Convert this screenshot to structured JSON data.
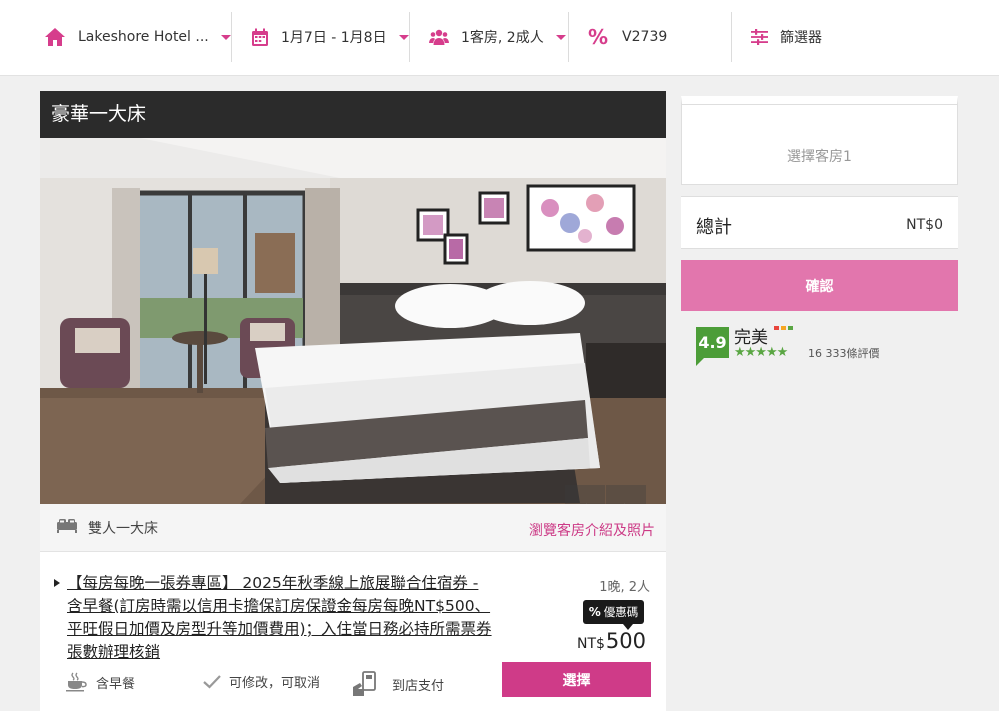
{
  "header": {
    "hotel_label": "Lakeshore Hotel ...",
    "dates_label": "1月7日 - 1月8日",
    "guests_label": "1客房, 2成人",
    "promo_code": "V2739",
    "filter_label": "篩選器"
  },
  "room": {
    "title": "豪華一大床",
    "carousel": {
      "total": 4,
      "active": 1
    },
    "bed_type": "雙人一大床",
    "browse_link": "瀏覽客房介紹及照片"
  },
  "offer": {
    "title": "【每房每晚一張券專區】 2025年秋季線上旅展聯合住宿券 - 含早餐(訂房時需以信用卡擔保訂房保證金每房每晚NT$500、平旺假日加價及房型升等加價費用)；入住當日務必持所需票券張數辦理核銷",
    "occupancy": "1晚, 2人",
    "coupon_label": "優惠碼",
    "price_currency": "NT$",
    "price_amount": "500",
    "select_label": "選擇",
    "features": {
      "breakfast": "含早餐",
      "modify": "可修改，可取消",
      "pay": "到店支付"
    }
  },
  "summary": {
    "room_slot": "選擇客房1",
    "total_label": "總計",
    "total_value": "NT$0",
    "confirm_label": "確認"
  },
  "rating": {
    "score": "4.9",
    "word": "完美",
    "stars": "★★★★★",
    "reviews": "16 333條評價"
  },
  "colors": {
    "accent": "#cf3b88",
    "accent_light": "#e276ad",
    "rating_green": "#4c9d38",
    "dark_header": "#2b2b2b"
  }
}
